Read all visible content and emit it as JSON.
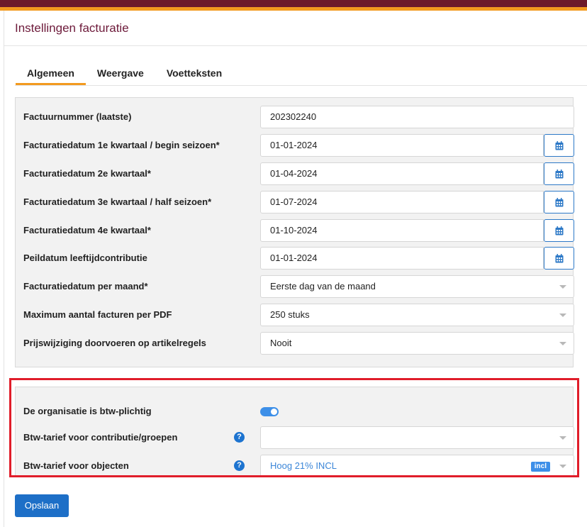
{
  "header": {
    "title": "Instellingen facturatie"
  },
  "tabs": [
    {
      "label": "Algemeen",
      "active": true
    },
    {
      "label": "Weergave",
      "active": false
    },
    {
      "label": "Voetteksten",
      "active": false
    }
  ],
  "general": {
    "invoice_number": {
      "label": "Factuurnummer (laatste)",
      "value": "202302240"
    },
    "date_q1": {
      "label": "Facturatiedatum 1e kwartaal / begin seizoen*",
      "value": "01-01-2024"
    },
    "date_q2": {
      "label": "Facturatiedatum 2e kwartaal*",
      "value": "01-04-2024"
    },
    "date_q3": {
      "label": "Facturatiedatum 3e kwartaal / half seizoen*",
      "value": "01-07-2024"
    },
    "date_q4": {
      "label": "Facturatiedatum 4e kwartaal*",
      "value": "01-10-2024"
    },
    "age_reference": {
      "label": "Peildatum leeftijdcontributie",
      "value": "01-01-2024"
    },
    "monthly_date": {
      "label": "Facturatiedatum per maand*",
      "value": "Eerste dag van de maand"
    },
    "max_per_pdf": {
      "label": "Maximum aantal facturen per PDF",
      "value": "250 stuks"
    },
    "price_change": {
      "label": "Prijswijziging doorvoeren op artikelregels",
      "value": "Nooit"
    }
  },
  "vat": {
    "liable": {
      "label": "De organisatie is btw-plichtig",
      "enabled": true
    },
    "rate_contribution": {
      "label": "Btw-tarief voor contributie/groepen",
      "value": "",
      "help": "?"
    },
    "rate_objects": {
      "label": "Btw-tarief voor objecten",
      "value": "Hoog 21% INCL",
      "badge": "incl",
      "help": "?"
    }
  },
  "actions": {
    "save_label": "Opslaan"
  },
  "colors": {
    "brand_dark": "#6d1a2a",
    "brand_orange": "#f39a1f",
    "primary": "#1d6fc7",
    "highlight_frame": "#e01d2a"
  },
  "icons": {
    "calendar": "calendar-icon",
    "help": "help-icon",
    "dropdown": "chevron-down-icon"
  }
}
